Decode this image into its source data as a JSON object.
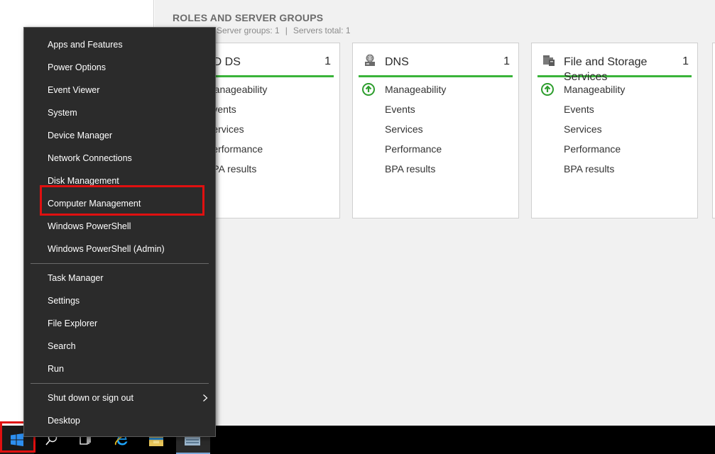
{
  "server_manager": {
    "section_title": "ROLES AND SERVER GROUPS",
    "summary_groups": "Server groups: 1",
    "summary_total": "Servers total: 1",
    "tiles": [
      {
        "title": "AD DS",
        "count": "1",
        "rows": [
          "Manageability",
          "Events",
          "Services",
          "Performance",
          "BPA results"
        ]
      },
      {
        "title": "DNS",
        "count": "1",
        "rows": [
          "Manageability",
          "Events",
          "Services",
          "Performance",
          "BPA results"
        ]
      },
      {
        "title": "File and Storage Services",
        "title_line1": "File and Storage",
        "title_line2": "Services",
        "count": "1",
        "rows": [
          "Manageability",
          "Events",
          "Services",
          "Performance",
          "BPA results"
        ]
      }
    ],
    "status_color": "#3ab43a"
  },
  "context_menu": {
    "items": [
      {
        "label": "Apps and Features"
      },
      {
        "label": "Power Options"
      },
      {
        "label": "Event Viewer"
      },
      {
        "label": "System"
      },
      {
        "label": "Device Manager"
      },
      {
        "label": "Network Connections"
      },
      {
        "label": "Disk Management"
      },
      {
        "label": "Computer Management",
        "highlighted": true
      },
      {
        "label": "Windows PowerShell"
      },
      {
        "label": "Windows PowerShell (Admin)"
      },
      {
        "label": "Task Manager"
      },
      {
        "label": "Settings"
      },
      {
        "label": "File Explorer"
      },
      {
        "label": "Search"
      },
      {
        "label": "Run"
      },
      {
        "label": "Shut down or sign out",
        "has_submenu": true
      },
      {
        "label": "Desktop"
      }
    ],
    "highlight_color": "#e01010"
  },
  "taskbar": {
    "icons": [
      "windows-start-icon",
      "search-icon",
      "task-view-icon",
      "internet-explorer-icon",
      "file-explorer-icon",
      "server-manager-icon"
    ]
  }
}
